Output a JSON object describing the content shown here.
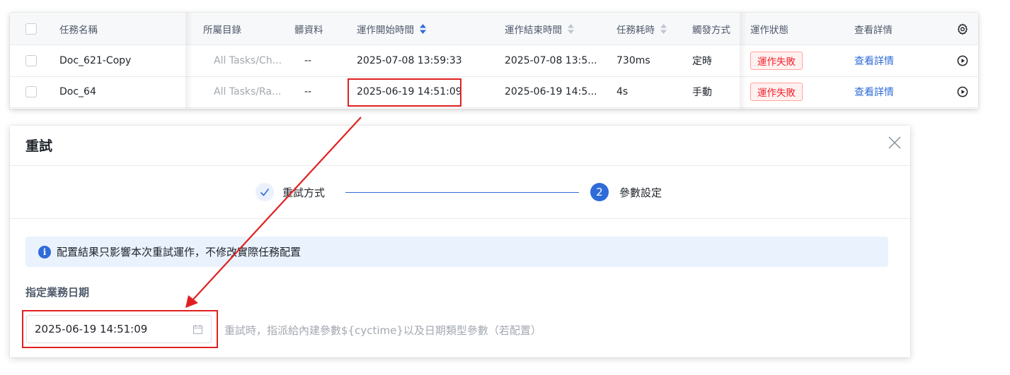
{
  "table": {
    "headers": {
      "task_name": "任務名稱",
      "directory": "所屬目錄",
      "dirty_data": "髒資料",
      "start_time": "運作開始時間",
      "end_time": "運作結束時間",
      "duration": "任務耗時",
      "trigger": "觸發方式",
      "status": "運作狀態",
      "details": "查看詳情"
    },
    "rows": [
      {
        "task_name": "Doc_621-Copy",
        "directory": "All Tasks/Ch...",
        "dirty_data": "--",
        "start_time": "2025-07-08 13:59:33",
        "end_time": "2025-07-08 13:5...",
        "duration": "730ms",
        "trigger": "定時",
        "status": "運作失敗",
        "details": "查看詳情"
      },
      {
        "task_name": "Doc_64",
        "directory": "All Tasks/Ra...",
        "dirty_data": "--",
        "start_time": "2025-06-19 14:51:09",
        "end_time": "2025-06-19 14:5...",
        "duration": "4s",
        "trigger": "手動",
        "status": "運作失敗",
        "details": "查看詳情"
      }
    ]
  },
  "dialog": {
    "title": "重試",
    "steps": [
      {
        "label": "重試方式",
        "state": "done"
      },
      {
        "number": "2",
        "label": "參數設定",
        "state": "active"
      }
    ],
    "info": "配置結果只影響本次重試運作，不修改實際任務配置",
    "field_label": "指定業務日期",
    "date_value": "2025-06-19 14:51:09",
    "field_help": "重試時，指派給內建參數${cyctime}以及日期類型參數（若配置）"
  },
  "colors": {
    "accent": "#2f6bd9",
    "status_fail": "#f5222d",
    "annotation": "#e02020"
  }
}
